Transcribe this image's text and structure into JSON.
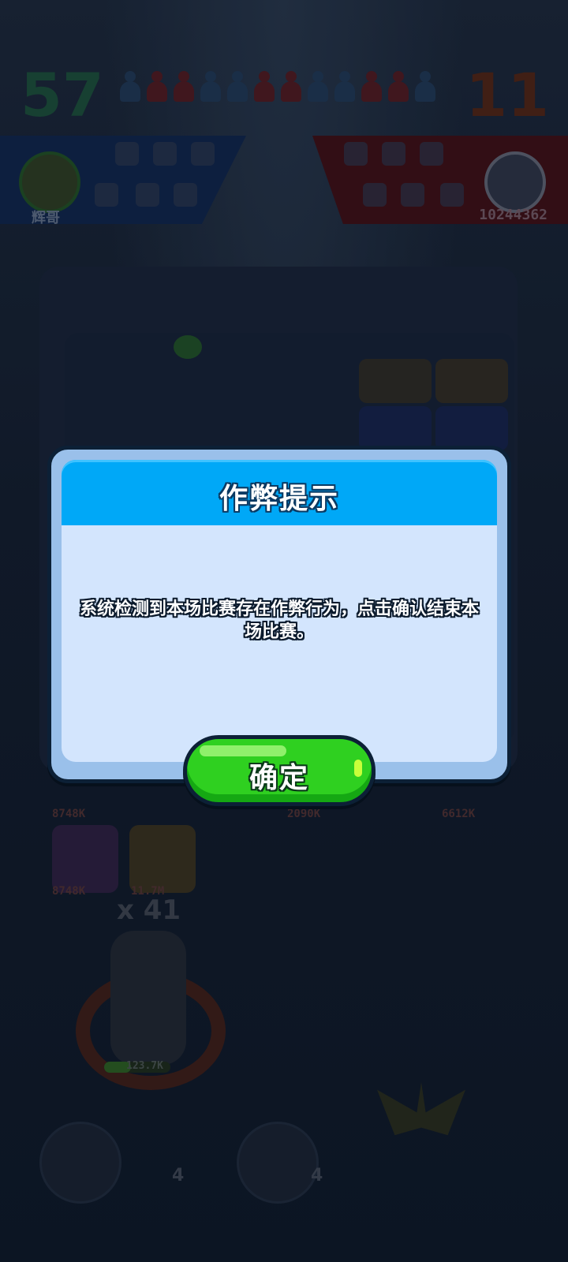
{
  "hud": {
    "left_score": "57",
    "right_score": "11",
    "pawns": [
      "blue",
      "red",
      "red",
      "blue",
      "blue",
      "red",
      "red",
      "blue",
      "blue",
      "red",
      "red",
      "blue"
    ],
    "left_player_name": "辉哥",
    "right_player_id": "10244362",
    "left_team_color": "#0f2447",
    "right_team_color": "#3a1016"
  },
  "board": {
    "card_stats": [
      "8748K",
      "8748K",
      "2090K",
      "6612K",
      "8748K",
      "11.7M"
    ],
    "multiplier": "x 41",
    "hero_health": "123.7K",
    "hero_health_fraction": 0.4,
    "skill_counts": [
      "4",
      "4"
    ]
  },
  "dialog": {
    "title": "作弊提示",
    "message": "系统检测到本场比赛存在作弊行为，点击确认结束本场比赛。",
    "confirm_label": "确定",
    "header_color": "#00a8f7",
    "body_color": "#d3e5fd",
    "button_color": "#2fd020"
  }
}
